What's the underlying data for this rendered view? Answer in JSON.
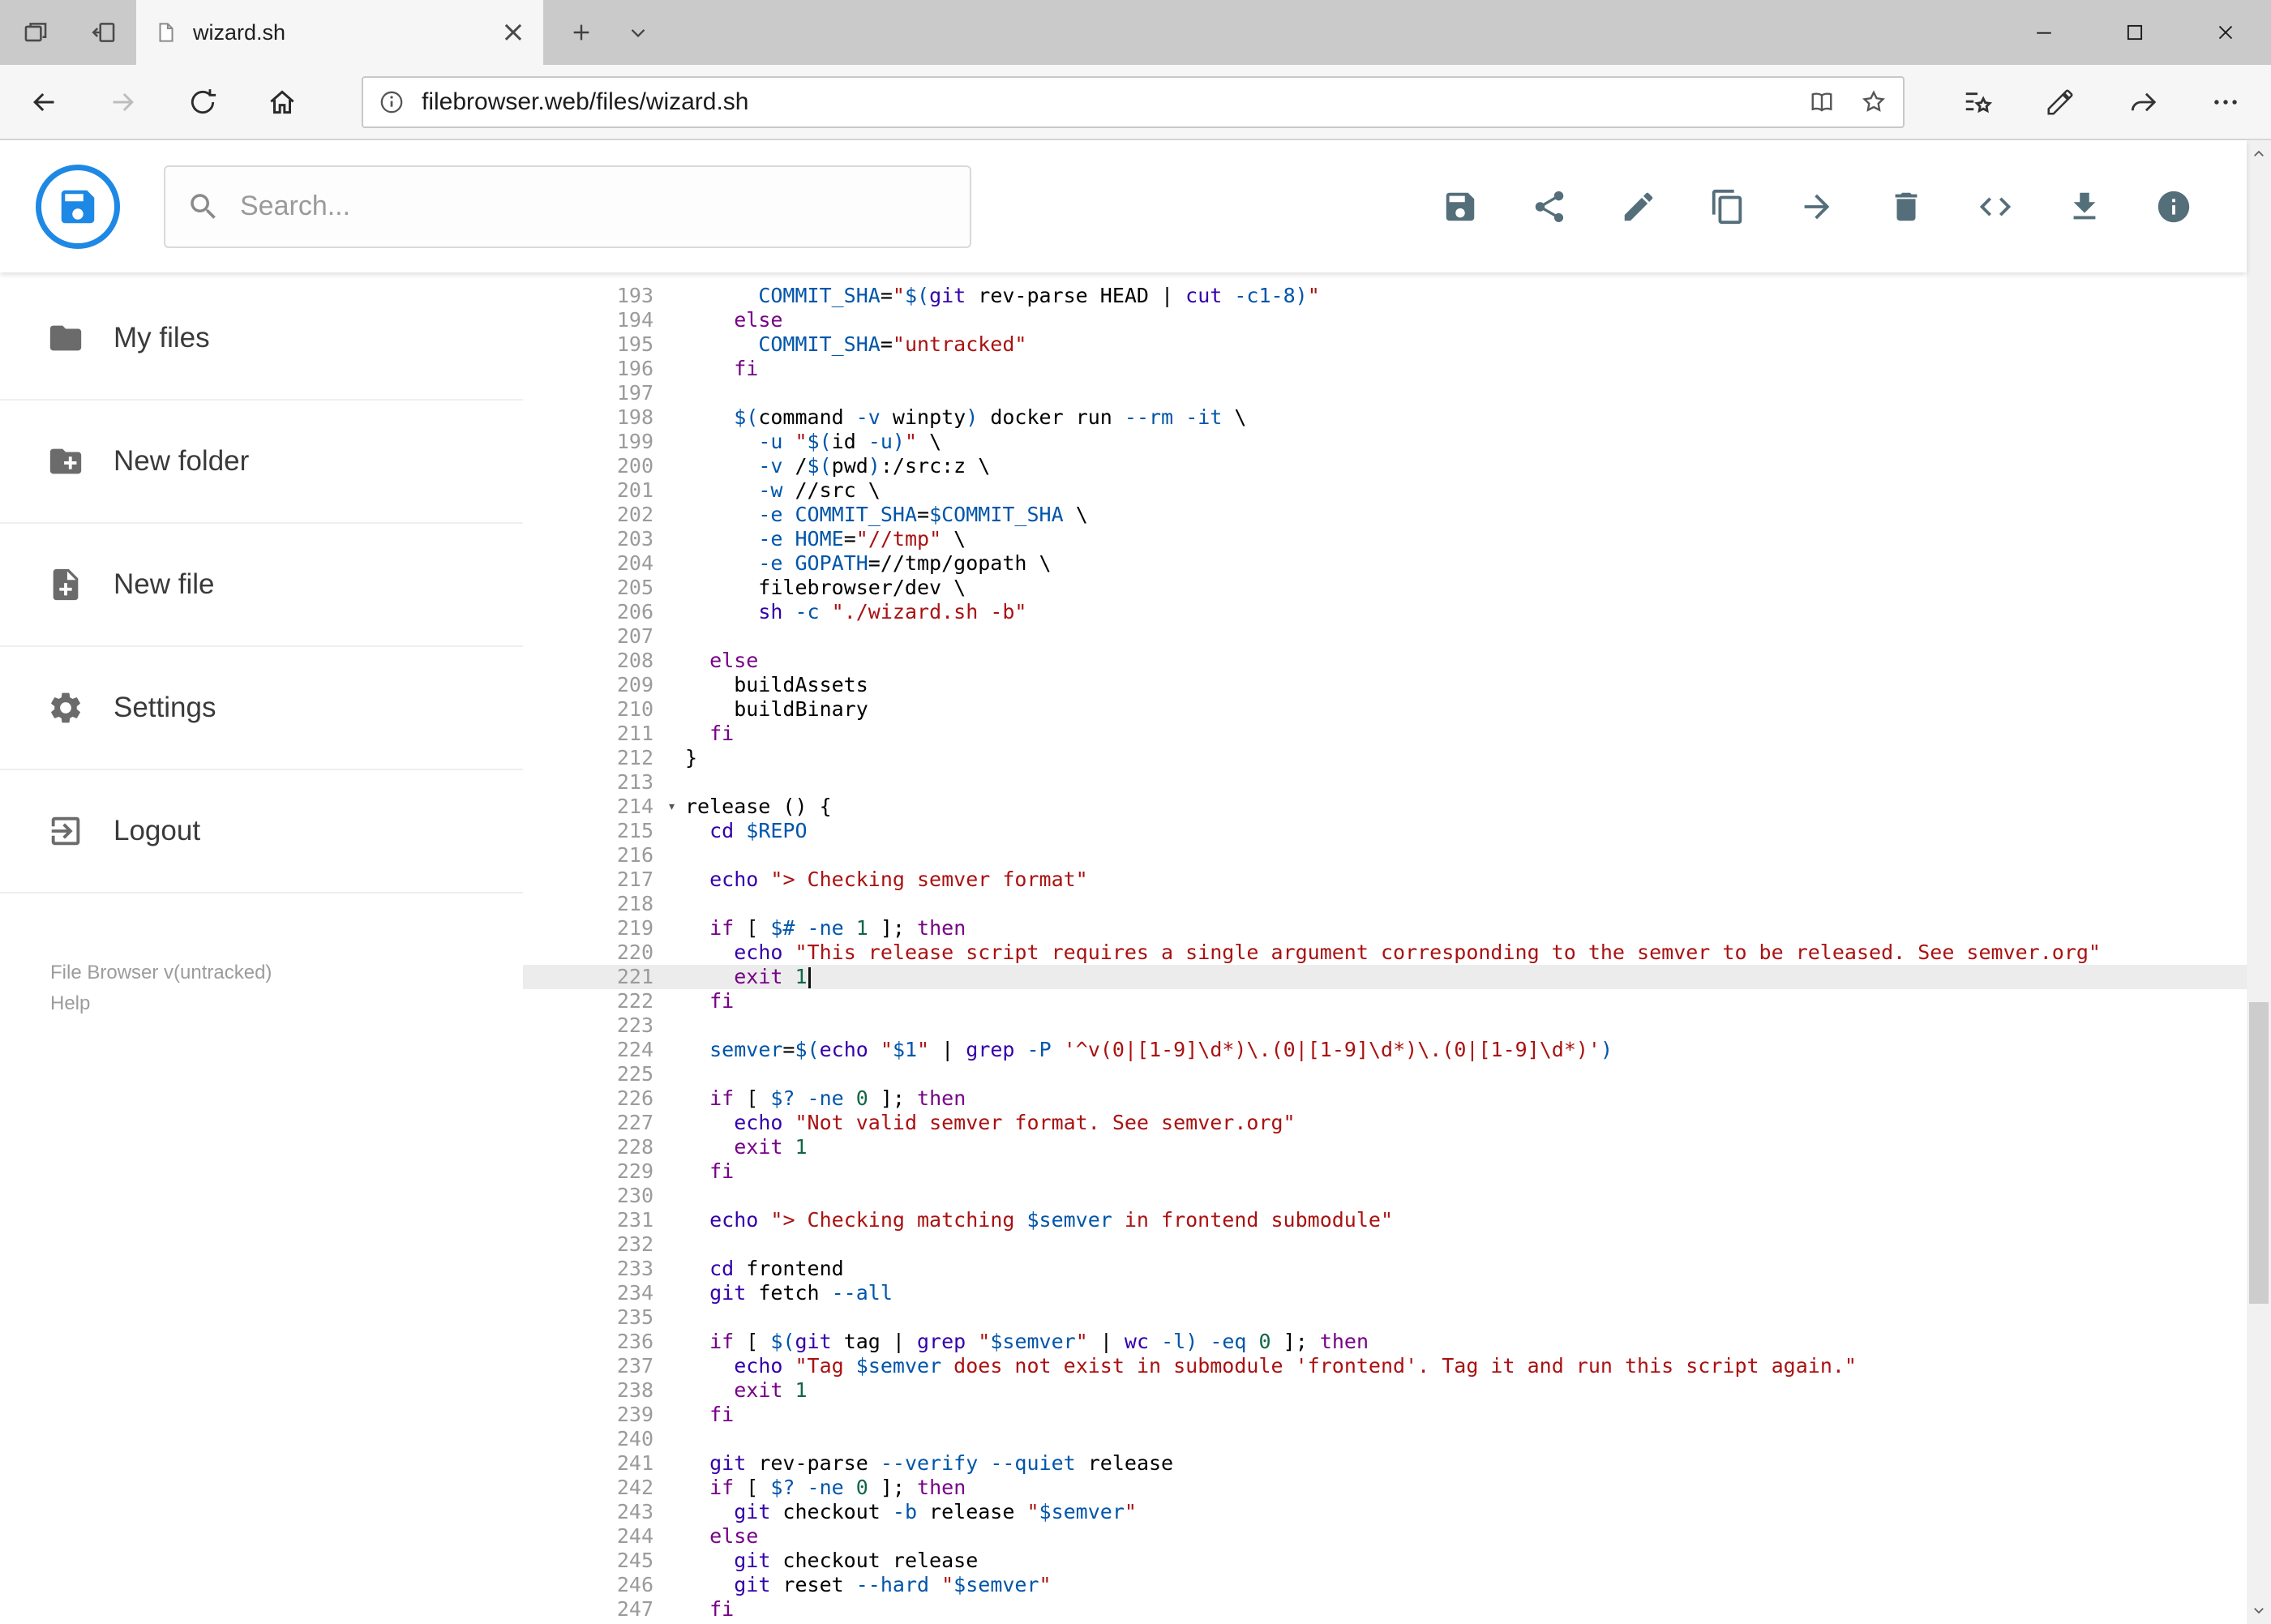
{
  "browser": {
    "tab_title": "wizard.sh",
    "url_host": "filebrowser.web",
    "url_path": "/files/wizard.sh"
  },
  "header": {
    "search_placeholder": "Search...",
    "toolbar_icons": [
      "save",
      "share",
      "edit",
      "copy",
      "move",
      "delete",
      "code",
      "download",
      "info"
    ]
  },
  "sidebar": {
    "items": [
      {
        "label": "My files",
        "icon": "folder"
      },
      {
        "label": "New folder",
        "icon": "create-new-folder"
      },
      {
        "label": "New file",
        "icon": "new-file"
      },
      {
        "label": "Settings",
        "icon": "settings-gear"
      },
      {
        "label": "Logout",
        "icon": "logout"
      }
    ],
    "footer_version": "File Browser v(untracked)",
    "footer_help": "Help"
  },
  "colors": {
    "accent_blue": "#1e88e5",
    "active_line_bg": "#ececec",
    "syntax": {
      "keyword": "#770088",
      "builtin": "#3300aa",
      "string": "#aa1111",
      "variable": "#0055aa",
      "attribute": "#0055aa",
      "number": "#116644"
    }
  },
  "editor": {
    "active_line": 221,
    "cursor_line": 221,
    "fold_marker_line": 214,
    "first_line": 193,
    "last_line": 247,
    "lines": [
      {
        "n": 193,
        "t": [
          [
            "p",
            "      "
          ],
          [
            "v",
            "COMMIT_SHA"
          ],
          [
            "p",
            "="
          ],
          [
            "s",
            "\""
          ],
          [
            "v",
            "$("
          ],
          [
            "b",
            "git"
          ],
          [
            "p",
            " rev-parse HEAD | "
          ],
          [
            "b",
            "cut"
          ],
          [
            "p",
            " "
          ],
          [
            "a",
            "-c1-8"
          ],
          [
            "v",
            ")"
          ],
          [
            "s",
            "\""
          ]
        ]
      },
      {
        "n": 194,
        "t": [
          [
            "p",
            "    "
          ],
          [
            "k",
            "else"
          ]
        ]
      },
      {
        "n": 195,
        "t": [
          [
            "p",
            "      "
          ],
          [
            "v",
            "COMMIT_SHA"
          ],
          [
            "p",
            "="
          ],
          [
            "s",
            "\"untracked\""
          ]
        ]
      },
      {
        "n": 196,
        "t": [
          [
            "p",
            "    "
          ],
          [
            "k",
            "fi"
          ]
        ]
      },
      {
        "n": 197,
        "t": []
      },
      {
        "n": 198,
        "t": [
          [
            "p",
            "    "
          ],
          [
            "v",
            "$("
          ],
          [
            "p",
            "command "
          ],
          [
            "a",
            "-v"
          ],
          [
            "p",
            " winpty"
          ],
          [
            "v",
            ")"
          ],
          [
            "p",
            " docker run "
          ],
          [
            "a",
            "--rm"
          ],
          [
            "p",
            " "
          ],
          [
            "a",
            "-it"
          ],
          [
            "p",
            " \\"
          ]
        ]
      },
      {
        "n": 199,
        "t": [
          [
            "p",
            "      "
          ],
          [
            "a",
            "-u"
          ],
          [
            "p",
            " "
          ],
          [
            "s",
            "\""
          ],
          [
            "v",
            "$("
          ],
          [
            "p",
            "id "
          ],
          [
            "a",
            "-u"
          ],
          [
            "v",
            ")"
          ],
          [
            "s",
            "\""
          ],
          [
            "p",
            " \\"
          ]
        ]
      },
      {
        "n": 200,
        "t": [
          [
            "p",
            "      "
          ],
          [
            "a",
            "-v"
          ],
          [
            "p",
            " /"
          ],
          [
            "v",
            "$("
          ],
          [
            "p",
            "pwd"
          ],
          [
            "v",
            ")"
          ],
          [
            "p",
            ":/src:z \\"
          ]
        ]
      },
      {
        "n": 201,
        "t": [
          [
            "p",
            "      "
          ],
          [
            "a",
            "-w"
          ],
          [
            "p",
            " //src \\"
          ]
        ]
      },
      {
        "n": 202,
        "t": [
          [
            "p",
            "      "
          ],
          [
            "a",
            "-e"
          ],
          [
            "p",
            " "
          ],
          [
            "v",
            "COMMIT_SHA"
          ],
          [
            "p",
            "="
          ],
          [
            "v",
            "$COMMIT_SHA"
          ],
          [
            "p",
            " \\"
          ]
        ]
      },
      {
        "n": 203,
        "t": [
          [
            "p",
            "      "
          ],
          [
            "a",
            "-e"
          ],
          [
            "p",
            " "
          ],
          [
            "v",
            "HOME"
          ],
          [
            "p",
            "="
          ],
          [
            "s",
            "\"//tmp\""
          ],
          [
            "p",
            " \\"
          ]
        ]
      },
      {
        "n": 204,
        "t": [
          [
            "p",
            "      "
          ],
          [
            "a",
            "-e"
          ],
          [
            "p",
            " "
          ],
          [
            "v",
            "GOPATH"
          ],
          [
            "p",
            "=//tmp/gopath \\"
          ]
        ]
      },
      {
        "n": 205,
        "t": [
          [
            "p",
            "      filebrowser/dev \\"
          ]
        ]
      },
      {
        "n": 206,
        "t": [
          [
            "p",
            "      "
          ],
          [
            "b",
            "sh"
          ],
          [
            "p",
            " "
          ],
          [
            "a",
            "-c"
          ],
          [
            "p",
            " "
          ],
          [
            "s",
            "\"./wizard.sh -b\""
          ]
        ]
      },
      {
        "n": 207,
        "t": []
      },
      {
        "n": 208,
        "t": [
          [
            "p",
            "  "
          ],
          [
            "k",
            "else"
          ]
        ]
      },
      {
        "n": 209,
        "t": [
          [
            "p",
            "    buildAssets"
          ]
        ]
      },
      {
        "n": 210,
        "t": [
          [
            "p",
            "    buildBinary"
          ]
        ]
      },
      {
        "n": 211,
        "t": [
          [
            "p",
            "  "
          ],
          [
            "k",
            "fi"
          ]
        ]
      },
      {
        "n": 212,
        "t": [
          [
            "p",
            "}"
          ]
        ]
      },
      {
        "n": 213,
        "t": []
      },
      {
        "n": 214,
        "t": [
          [
            "p",
            "release () {"
          ]
        ]
      },
      {
        "n": 215,
        "t": [
          [
            "p",
            "  "
          ],
          [
            "b",
            "cd"
          ],
          [
            "p",
            " "
          ],
          [
            "v",
            "$REPO"
          ]
        ]
      },
      {
        "n": 216,
        "t": []
      },
      {
        "n": 217,
        "t": [
          [
            "p",
            "  "
          ],
          [
            "b",
            "echo"
          ],
          [
            "p",
            " "
          ],
          [
            "s",
            "\"> Checking semver format\""
          ]
        ]
      },
      {
        "n": 218,
        "t": []
      },
      {
        "n": 219,
        "t": [
          [
            "p",
            "  "
          ],
          [
            "k",
            "if"
          ],
          [
            "p",
            " [ "
          ],
          [
            "v",
            "$#"
          ],
          [
            "p",
            " "
          ],
          [
            "a",
            "-ne"
          ],
          [
            "p",
            " "
          ],
          [
            "n",
            "1"
          ],
          [
            "p",
            " ]; "
          ],
          [
            "k",
            "then"
          ]
        ]
      },
      {
        "n": 220,
        "t": [
          [
            "p",
            "    "
          ],
          [
            "b",
            "echo"
          ],
          [
            "p",
            " "
          ],
          [
            "s",
            "\"This release script requires a single argument corresponding to the semver to be released. See semver.org\""
          ]
        ]
      },
      {
        "n": 221,
        "t": [
          [
            "p",
            "    "
          ],
          [
            "k",
            "exit"
          ],
          [
            "p",
            " "
          ],
          [
            "n",
            "1"
          ]
        ]
      },
      {
        "n": 222,
        "t": [
          [
            "p",
            "  "
          ],
          [
            "k",
            "fi"
          ]
        ]
      },
      {
        "n": 223,
        "t": []
      },
      {
        "n": 224,
        "t": [
          [
            "p",
            "  "
          ],
          [
            "v",
            "semver"
          ],
          [
            "p",
            "="
          ],
          [
            "v",
            "$("
          ],
          [
            "b",
            "echo"
          ],
          [
            "p",
            " "
          ],
          [
            "s",
            "\""
          ],
          [
            "v",
            "$1"
          ],
          [
            "s",
            "\""
          ],
          [
            "p",
            " | "
          ],
          [
            "b",
            "grep"
          ],
          [
            "p",
            " "
          ],
          [
            "a",
            "-P"
          ],
          [
            "p",
            " "
          ],
          [
            "s",
            "'^v(0|[1-9]\\d*)\\.(0|[1-9]\\d*)\\.(0|[1-9]\\d*)'"
          ],
          [
            "v",
            ")"
          ]
        ]
      },
      {
        "n": 225,
        "t": []
      },
      {
        "n": 226,
        "t": [
          [
            "p",
            "  "
          ],
          [
            "k",
            "if"
          ],
          [
            "p",
            " [ "
          ],
          [
            "v",
            "$?"
          ],
          [
            "p",
            " "
          ],
          [
            "a",
            "-ne"
          ],
          [
            "p",
            " "
          ],
          [
            "n",
            "0"
          ],
          [
            "p",
            " ]; "
          ],
          [
            "k",
            "then"
          ]
        ]
      },
      {
        "n": 227,
        "t": [
          [
            "p",
            "    "
          ],
          [
            "b",
            "echo"
          ],
          [
            "p",
            " "
          ],
          [
            "s",
            "\"Not valid semver format. See semver.org\""
          ]
        ]
      },
      {
        "n": 228,
        "t": [
          [
            "p",
            "    "
          ],
          [
            "k",
            "exit"
          ],
          [
            "p",
            " "
          ],
          [
            "n",
            "1"
          ]
        ]
      },
      {
        "n": 229,
        "t": [
          [
            "p",
            "  "
          ],
          [
            "k",
            "fi"
          ]
        ]
      },
      {
        "n": 230,
        "t": []
      },
      {
        "n": 231,
        "t": [
          [
            "p",
            "  "
          ],
          [
            "b",
            "echo"
          ],
          [
            "p",
            " "
          ],
          [
            "s",
            "\"> Checking matching "
          ],
          [
            "v",
            "$semver"
          ],
          [
            "s",
            " in frontend submodule\""
          ]
        ]
      },
      {
        "n": 232,
        "t": []
      },
      {
        "n": 233,
        "t": [
          [
            "p",
            "  "
          ],
          [
            "b",
            "cd"
          ],
          [
            "p",
            " frontend"
          ]
        ]
      },
      {
        "n": 234,
        "t": [
          [
            "p",
            "  "
          ],
          [
            "b",
            "git"
          ],
          [
            "p",
            " fetch "
          ],
          [
            "a",
            "--all"
          ]
        ]
      },
      {
        "n": 235,
        "t": []
      },
      {
        "n": 236,
        "t": [
          [
            "p",
            "  "
          ],
          [
            "k",
            "if"
          ],
          [
            "p",
            " [ "
          ],
          [
            "v",
            "$("
          ],
          [
            "b",
            "git"
          ],
          [
            "p",
            " tag | "
          ],
          [
            "b",
            "grep"
          ],
          [
            "p",
            " "
          ],
          [
            "s",
            "\""
          ],
          [
            "v",
            "$semver"
          ],
          [
            "s",
            "\""
          ],
          [
            "p",
            " | "
          ],
          [
            "b",
            "wc"
          ],
          [
            "p",
            " "
          ],
          [
            "a",
            "-l"
          ],
          [
            "v",
            ")"
          ],
          [
            "p",
            " "
          ],
          [
            "a",
            "-eq"
          ],
          [
            "p",
            " "
          ],
          [
            "n",
            "0"
          ],
          [
            "p",
            " ]; "
          ],
          [
            "k",
            "then"
          ]
        ]
      },
      {
        "n": 237,
        "t": [
          [
            "p",
            "    "
          ],
          [
            "b",
            "echo"
          ],
          [
            "p",
            " "
          ],
          [
            "s",
            "\"Tag "
          ],
          [
            "v",
            "$semver"
          ],
          [
            "s",
            " does not exist in submodule 'frontend'. Tag it and run this script again.\""
          ]
        ]
      },
      {
        "n": 238,
        "t": [
          [
            "p",
            "    "
          ],
          [
            "k",
            "exit"
          ],
          [
            "p",
            " "
          ],
          [
            "n",
            "1"
          ]
        ]
      },
      {
        "n": 239,
        "t": [
          [
            "p",
            "  "
          ],
          [
            "k",
            "fi"
          ]
        ]
      },
      {
        "n": 240,
        "t": []
      },
      {
        "n": 241,
        "t": [
          [
            "p",
            "  "
          ],
          [
            "b",
            "git"
          ],
          [
            "p",
            " rev-parse "
          ],
          [
            "a",
            "--verify"
          ],
          [
            "p",
            " "
          ],
          [
            "a",
            "--quiet"
          ],
          [
            "p",
            " release"
          ]
        ]
      },
      {
        "n": 242,
        "t": [
          [
            "p",
            "  "
          ],
          [
            "k",
            "if"
          ],
          [
            "p",
            " [ "
          ],
          [
            "v",
            "$?"
          ],
          [
            "p",
            " "
          ],
          [
            "a",
            "-ne"
          ],
          [
            "p",
            " "
          ],
          [
            "n",
            "0"
          ],
          [
            "p",
            " ]; "
          ],
          [
            "k",
            "then"
          ]
        ]
      },
      {
        "n": 243,
        "t": [
          [
            "p",
            "    "
          ],
          [
            "b",
            "git"
          ],
          [
            "p",
            " checkout "
          ],
          [
            "a",
            "-b"
          ],
          [
            "p",
            " release "
          ],
          [
            "s",
            "\""
          ],
          [
            "v",
            "$semver"
          ],
          [
            "s",
            "\""
          ]
        ]
      },
      {
        "n": 244,
        "t": [
          [
            "p",
            "  "
          ],
          [
            "k",
            "else"
          ]
        ]
      },
      {
        "n": 245,
        "t": [
          [
            "p",
            "    "
          ],
          [
            "b",
            "git"
          ],
          [
            "p",
            " checkout release"
          ]
        ]
      },
      {
        "n": 246,
        "t": [
          [
            "p",
            "    "
          ],
          [
            "b",
            "git"
          ],
          [
            "p",
            " reset "
          ],
          [
            "a",
            "--hard"
          ],
          [
            "p",
            " "
          ],
          [
            "s",
            "\""
          ],
          [
            "v",
            "$semver"
          ],
          [
            "s",
            "\""
          ]
        ]
      },
      {
        "n": 247,
        "t": [
          [
            "p",
            "  "
          ],
          [
            "k",
            "fi"
          ]
        ]
      }
    ]
  }
}
